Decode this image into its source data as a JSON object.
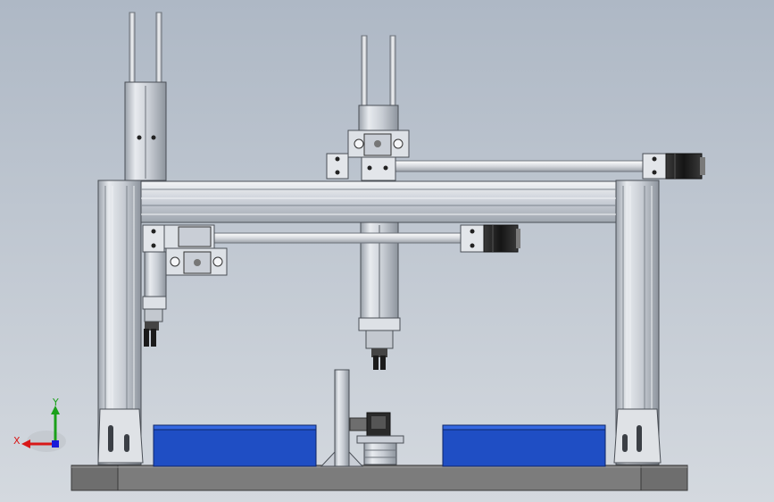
{
  "viewport": {
    "background_top": "#aeb8c5",
    "background_bottom": "#d4d9df"
  },
  "triad": {
    "x_label": "X",
    "y_label": "Y",
    "x_color": "#d81818",
    "y_color": "#1aa01a",
    "z_color": "#1a1ad8"
  },
  "colors": {
    "frame_aluminum": "#c9ced6",
    "frame_shadow": "#8c949e",
    "base_plate": "#6f6f6f",
    "tray_blue": "#1e4fc8",
    "motor_dark": "#2b2b2b",
    "rod": "#e6e8ec"
  }
}
